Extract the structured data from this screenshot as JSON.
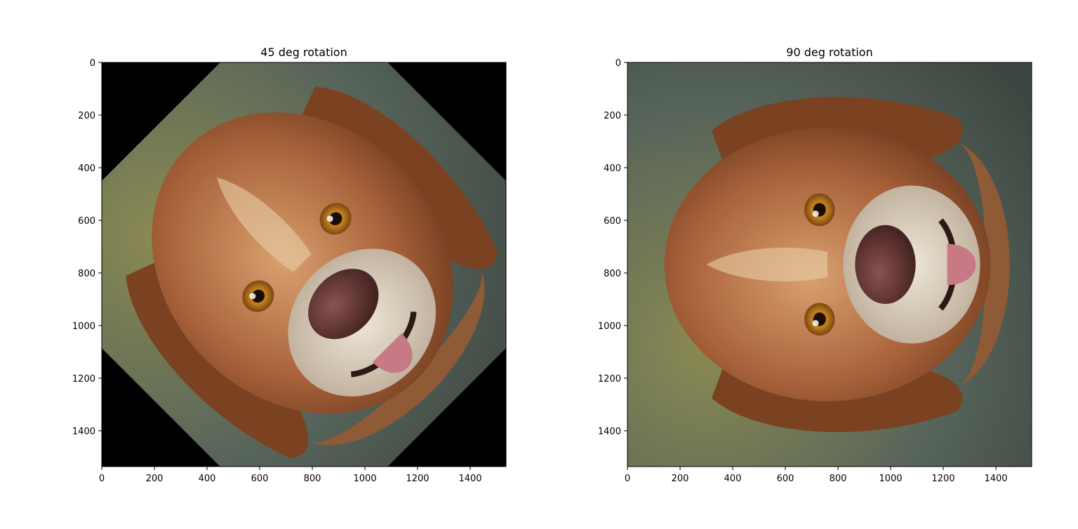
{
  "chart_data": [
    {
      "type": "image",
      "title": "45 deg rotation",
      "xlim": [
        0,
        1536
      ],
      "ylim": [
        1536,
        0
      ],
      "xticks": [
        0,
        200,
        400,
        600,
        800,
        1000,
        1200,
        1400
      ],
      "yticks": [
        0,
        200,
        400,
        600,
        800,
        1000,
        1200,
        1400
      ],
      "xtick_labels": [
        "0",
        "200",
        "400",
        "600",
        "800",
        "1000",
        "1200",
        "1400"
      ],
      "ytick_labels": [
        "0",
        "200",
        "400",
        "600",
        "800",
        "1000",
        "1200",
        "1400"
      ],
      "rotation_deg": 45,
      "grid": false
    },
    {
      "type": "image",
      "title": "90 deg rotation",
      "xlim": [
        0,
        1536
      ],
      "ylim": [
        1536,
        0
      ],
      "xticks": [
        0,
        200,
        400,
        600,
        800,
        1000,
        1200,
        1400
      ],
      "yticks": [
        0,
        200,
        400,
        600,
        800,
        1000,
        1200,
        1400
      ],
      "xtick_labels": [
        "0",
        "200",
        "400",
        "600",
        "800",
        "1000",
        "1200",
        "1400"
      ],
      "ytick_labels": [
        "0",
        "200",
        "400",
        "600",
        "800",
        "1000",
        "1200",
        "1400"
      ],
      "rotation_deg": 90,
      "grid": false
    }
  ],
  "colors": {
    "fur_dark": "#6b3a1c",
    "fur_mid": "#a9623a",
    "fur_light": "#d9a070",
    "muzzle": "#e6dccd",
    "nose": "#5a2e2a",
    "tongue": "#c77a85",
    "eye": "#c9861f",
    "background_corner": "#000000",
    "background_scene": "#56635a"
  }
}
